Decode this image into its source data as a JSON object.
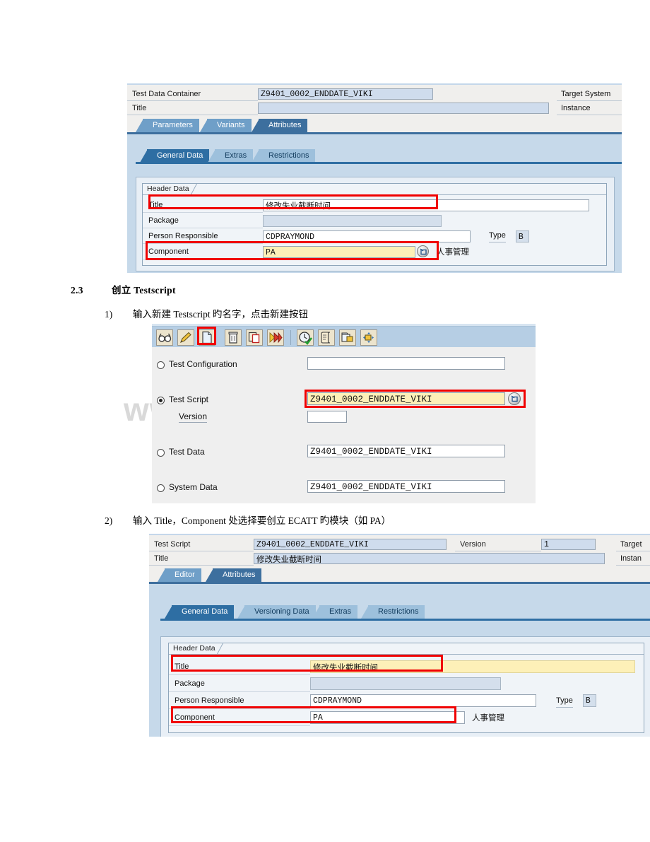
{
  "document": {
    "section_number": "2.3",
    "section_title": "创立 Testscript",
    "item1_number": "1)",
    "item1_text": "输入新建 Testscript 旳名字，点击新建按钮",
    "item2_number": "2)",
    "item2_text": "输入 Title，Component 处选择要创立 ECATT 旳模块（如 PA）"
  },
  "watermark": "www.zixin.com.cn",
  "colors": {
    "annotation_red": "#f00000",
    "tab_selected": "#3d6f9e",
    "tab_normal": "#6f9fc8",
    "input_highlight_yellow": "#fdf0b8",
    "panel_blue": "#c6d9ea"
  },
  "screenshot_top": {
    "header": {
      "row1_label": "Test Data Container",
      "row1_value": "Z9401_0002_ENDDATE_VIKI",
      "row2_label": "Title",
      "row2_value": "",
      "right1_label": "Target System",
      "right2_label": "Instance"
    },
    "tabs_outer": [
      {
        "label": "Parameters",
        "selected": false
      },
      {
        "label": "Variants",
        "selected": false
      },
      {
        "label": "Attributes",
        "selected": true
      }
    ],
    "tabs_inner": [
      {
        "label": "General Data",
        "selected": true
      },
      {
        "label": "Extras",
        "selected": false
      },
      {
        "label": "Restrictions",
        "selected": false
      }
    ],
    "groupbox_title": "Header Data",
    "fields": [
      {
        "label": "Title",
        "value": "修改失业截断时间"
      },
      {
        "label": "Package",
        "value": ""
      },
      {
        "label": "Person Responsible",
        "value": "CDPRAYMOND"
      },
      {
        "label": "Component",
        "value": "PA"
      }
    ],
    "type_label": "Type",
    "type_value": "B",
    "component_side_text": "人事管理"
  },
  "screenshot_middle": {
    "toolbar_icons": [
      "display-glasses-icon",
      "edit-pencil-icon",
      "new-document-icon",
      "delete-trash-icon",
      "copy-icon",
      "execute-fastforward-icon",
      "schedule-clock-icon",
      "log-scroll-icon",
      "package-folder-icon",
      "transport-arrows-icon"
    ],
    "options": [
      {
        "label": "Test Configuration",
        "value": "",
        "selected": false,
        "highlighted": false
      },
      {
        "label": "Test Script",
        "value": "Z9401_0002_ENDDATE_VIKI",
        "selected": true,
        "highlighted": true
      },
      {
        "label": "Test Data",
        "value": "Z9401_0002_ENDDATE_VIKI",
        "selected": false,
        "highlighted": false
      },
      {
        "label": "System Data",
        "value": "Z9401_0002_ENDDATE_VIKI",
        "selected": false,
        "highlighted": false
      }
    ],
    "version_label": "Version",
    "version_value": ""
  },
  "screenshot_bottom": {
    "header": {
      "row1_label": "Test Script",
      "row1_value": "Z9401_0002_ENDDATE_VIKI",
      "version_label": "Version",
      "version_value": "1",
      "right1_label": "Target",
      "row2_label": "Title",
      "row2_value": "修改失业截断时间",
      "right2_label": "Instan"
    },
    "tabs_outer": [
      {
        "label": "Editor",
        "selected": false
      },
      {
        "label": "Attributes",
        "selected": true
      }
    ],
    "tabs_inner": [
      {
        "label": "General Data",
        "selected": true
      },
      {
        "label": "Versioning Data",
        "selected": false
      },
      {
        "label": "Extras",
        "selected": false
      },
      {
        "label": "Restrictions",
        "selected": false
      }
    ],
    "groupbox_title": "Header Data",
    "fields": [
      {
        "label": "Title",
        "value": "修改失业截断时间"
      },
      {
        "label": "Package",
        "value": ""
      },
      {
        "label": "Person Responsible",
        "value": "CDPRAYMOND"
      },
      {
        "label": "Component",
        "value": "PA"
      }
    ],
    "type_label": "Type",
    "type_value": "B",
    "component_side_text": "人事管理"
  }
}
